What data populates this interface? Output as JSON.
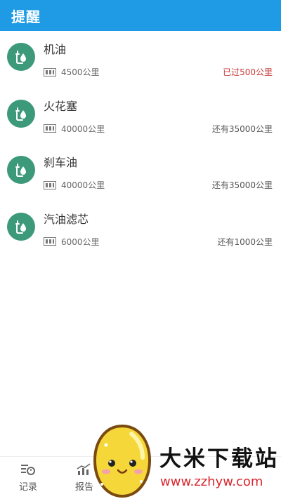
{
  "header": {
    "title": "提醒",
    "bg_color": "#1e9be4"
  },
  "items": [
    {
      "name": "机油",
      "mileage": "4500公里",
      "status": "已过500公里",
      "overdue": true,
      "icon": "oil-drop-icon"
    },
    {
      "name": "火花塞",
      "mileage": "40000公里",
      "status": "还有35000公里",
      "overdue": false,
      "icon": "oil-drop-icon"
    },
    {
      "name": "刹车油",
      "mileage": "40000公里",
      "status": "还有35000公里",
      "overdue": false,
      "icon": "oil-drop-icon"
    },
    {
      "name": "汽油滤芯",
      "mileage": "6000公里",
      "status": "还有1000公里",
      "overdue": false,
      "icon": "oil-drop-icon"
    }
  ],
  "colors": {
    "icon_bg": "#3c9a7a",
    "overdue": "#c73a3a"
  },
  "bottom_nav": {
    "items": [
      {
        "label": "记录",
        "icon": "record-icon"
      },
      {
        "label": "报告",
        "icon": "report-chart-icon"
      }
    ]
  },
  "watermark": {
    "title": "大米下载站",
    "url": "www.zzhyw.com"
  }
}
